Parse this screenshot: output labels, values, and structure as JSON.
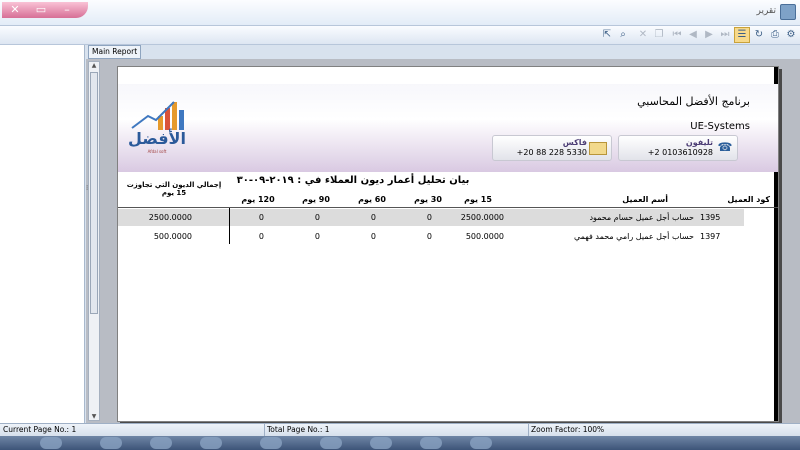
{
  "window": {
    "title": "تقرير"
  },
  "toolbar": {
    "icons": [
      "export-icon",
      "search-icon",
      "binoculars-icon",
      "close-icon",
      "copy-icon",
      "first-page-icon",
      "prev-page-icon",
      "next-page-icon",
      "last-page-icon",
      "tree-toggle-icon",
      "refresh-icon",
      "print-icon",
      "page-setup-icon"
    ]
  },
  "tabs": {
    "main_report": "Main Report"
  },
  "report": {
    "company_name": "برنامج الأفضل المحاسبي",
    "subtitle": "UE-Systems",
    "phone_label": "تليفون",
    "phone_value": "+2 0103610928",
    "fax_label": "فاكس",
    "fax_value": "+20 88 228 5330",
    "logo_text": "الأفضل",
    "logo_sub": "Afdal soft",
    "title": "بيان تحليل أعمار ديون العملاء في : ٢٠١٩-٠٩-٣٠",
    "columns": {
      "code": "كود العميل",
      "name": "أسم العميل",
      "d15": "15 يوم",
      "d30": "30 يوم",
      "d60": "60 يوم",
      "d90": "90 يوم",
      "d120": "120 يوم",
      "total_line1": "إجمالي الديون التي تجاوزت",
      "total_line2": "15 يوم"
    },
    "rows": [
      {
        "code": "1395",
        "name": "حساب أجل عميل حسام محمود",
        "d15": "2500.0000",
        "d30": "0",
        "d60": "0",
        "d90": "0",
        "d120": "0",
        "total": "2500.0000"
      },
      {
        "code": "1397",
        "name": "حساب أجل عميل رامي محمد فهمي",
        "d15": "500.0000",
        "d30": "0",
        "d60": "0",
        "d90": "0",
        "d120": "0",
        "total": "500.0000"
      }
    ]
  },
  "status": {
    "current_page": "Current Page No.: 1",
    "total_page": "Total Page No.: 1",
    "zoom": "Zoom Factor: 100%"
  }
}
